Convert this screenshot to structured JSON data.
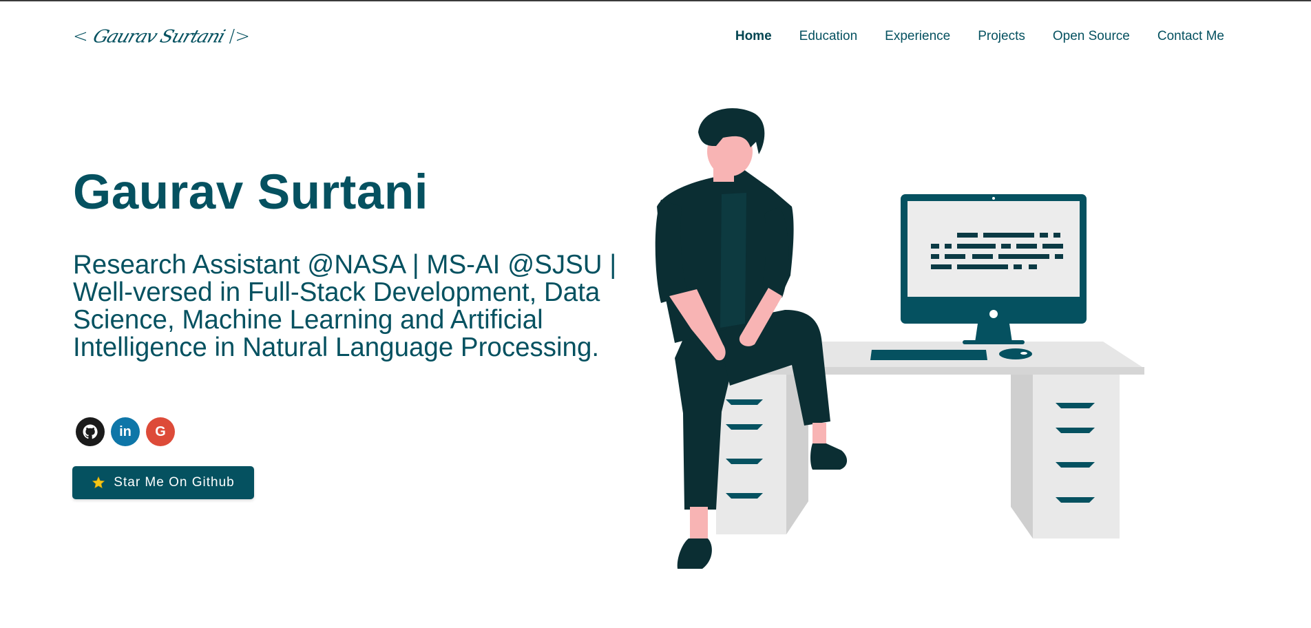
{
  "logo": {
    "open": "<",
    "signature": "Gaurav Surtani",
    "close": "/>"
  },
  "nav": {
    "items": [
      {
        "label": "Home",
        "active": true
      },
      {
        "label": "Education",
        "active": false
      },
      {
        "label": "Experience",
        "active": false
      },
      {
        "label": "Projects",
        "active": false
      },
      {
        "label": "Open Source",
        "active": false
      },
      {
        "label": "Contact Me",
        "active": false
      }
    ]
  },
  "hero": {
    "title": "Gaurav Surtani",
    "subtitle": "Research Assistant @NASA | MS-AI @SJSU | Well-versed in Full-Stack Development, Data Science, Machine Learning and Artificial Intelligence in Natural Language Processing."
  },
  "socials": [
    {
      "icon": "github-icon",
      "color": "#1b1b1b"
    },
    {
      "icon": "linkedin-icon",
      "label": "in",
      "color": "#0e76a8"
    },
    {
      "icon": "google-icon",
      "label": "G",
      "color": "#dd4b39"
    }
  ],
  "cta": {
    "icon": "star-icon",
    "label": "Star Me On Github"
  },
  "colors": {
    "primary": "#055160",
    "figure_dark": "#0b2e33",
    "skin": "#f8b4b4",
    "desk": "#e6e6e6"
  }
}
